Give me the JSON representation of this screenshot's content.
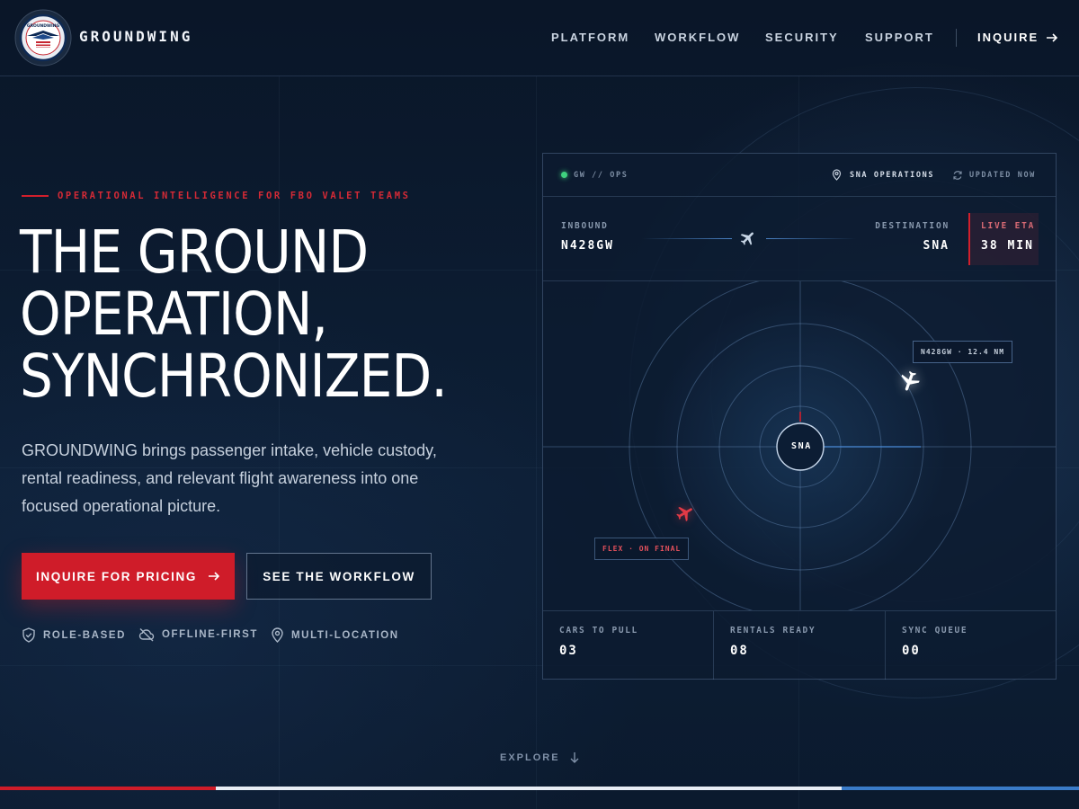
{
  "brand": {
    "name": "GROUNDWING",
    "logo_text": "GROUNDWING"
  },
  "nav": {
    "items": [
      {
        "label": "PLATFORM"
      },
      {
        "label": "WORKFLOW"
      },
      {
        "label": "SECURITY"
      },
      {
        "label": "SUPPORT"
      }
    ],
    "inquire_label": "INQUIRE"
  },
  "hero": {
    "eyebrow": "OPERATIONAL INTELLIGENCE FOR FBO VALET TEAMS",
    "headline": [
      "THE GROUND",
      "OPERATION,",
      "SYNCHRONIZED."
    ],
    "lede": "GROUNDWING brings passenger intake, vehicle custody, rental readiness, and relevant flight awareness into one focused operational picture.",
    "primary_cta": "INQUIRE FOR PRICING",
    "secondary_cta": "SEE THE WORKFLOW",
    "features": [
      {
        "label": "ROLE-BASED",
        "icon": "shield-check-icon"
      },
      {
        "label": "OFFLINE-FIRST",
        "icon": "cloud-off-icon"
      },
      {
        "label": "MULTI-LOCATION",
        "icon": "map-pin-icon"
      }
    ]
  },
  "panel": {
    "status_label": "GW // OPS",
    "location": "SNA OPERATIONS",
    "updated": "UPDATED NOW",
    "inbound_label": "INBOUND",
    "inbound_tail": "N428GW",
    "destination_label": "DESTINATION",
    "destination": "SNA",
    "eta_label": "LIVE ETA",
    "eta_value": "38 MIN",
    "radar": {
      "center_label": "SNA",
      "target_tag": "N428GW · 12.4 NM",
      "alert_tag": "FLEX · ON FINAL"
    },
    "stats": [
      {
        "label": "CARS TO PULL",
        "value": "03"
      },
      {
        "label": "RENTALS READY",
        "value": "08"
      },
      {
        "label": "SYNC QUEUE",
        "value": "00"
      }
    ]
  },
  "explore_label": "EXPLORE",
  "colors": {
    "accent_red": "#cf1c29",
    "accent_blue": "#3a7bc8",
    "status_green": "#3fd27e",
    "background": "#0b1a2e"
  }
}
